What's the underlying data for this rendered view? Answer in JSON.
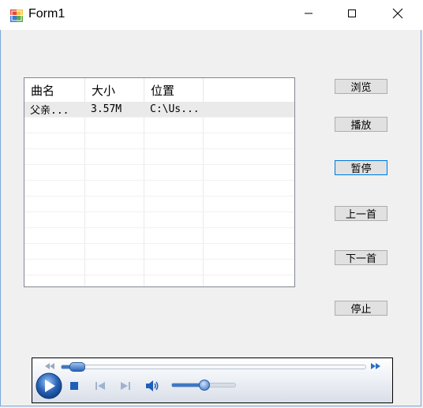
{
  "window": {
    "title": "Form1",
    "app_icon": "winforms-app-icon"
  },
  "titlebar_buttons": {
    "minimize": "minimize-icon",
    "maximize": "maximize-icon",
    "close": "close-icon"
  },
  "listview": {
    "columns": [
      "曲名",
      "大小",
      "位置"
    ],
    "rows": [
      {
        "name": "父亲...",
        "size": "3.57M",
        "location": "C:\\Us..."
      }
    ],
    "selected_row": 0
  },
  "buttons": {
    "browse": "浏览",
    "play": "播放",
    "pause": "暂停",
    "previous": "上一首",
    "next": "下一首",
    "stop": "停止"
  },
  "focused_button": "pause",
  "player": {
    "seek_position": 0.03,
    "volume": 0.5,
    "controls": [
      "play-icon",
      "stop-icon",
      "previous-icon",
      "next-icon",
      "volume-icon"
    ]
  },
  "colors": {
    "title_bar": "#ffffff",
    "window_bg": "#f0f0f0",
    "accent": "#0078d7",
    "player_blue": "#2b64b6"
  }
}
